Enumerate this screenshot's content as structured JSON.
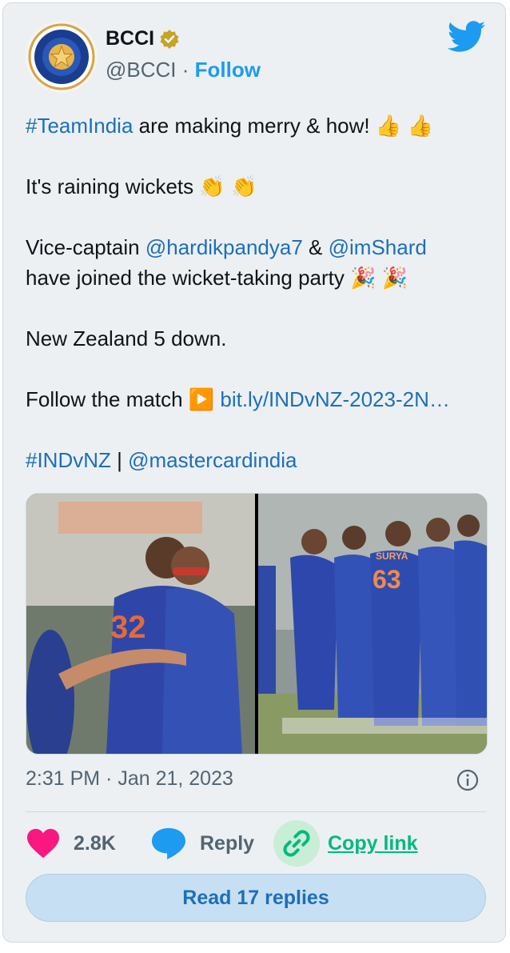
{
  "author": {
    "name": "BCCI",
    "handle": "@BCCI",
    "separator": "·",
    "follow_label": "Follow",
    "verified_color": "#c9a227"
  },
  "tweet": {
    "line1_hashtag": "#TeamIndia",
    "line1_text": " are making merry & how! ",
    "line1_emoji": "👍 👍",
    "line2_text": "It's raining wickets ",
    "line2_emoji": "👏 👏",
    "line3_text": "Vice-captain ",
    "line3_mention1": "@hardikpandya7",
    "line3_amp": " & ",
    "line3_mention2": "@imShard",
    "line4_text": "have joined the wicket-taking party ",
    "line4_emoji": "🎉 🎉",
    "line5_text": "New Zealand 5 down.",
    "line6_text": "Follow the match ",
    "line6_emoji": "▶️",
    "line6_link": "bit.ly/INDvNZ-2023-2N…",
    "line7_hashtag": "#INDvNZ",
    "line7_sep": " | ",
    "line7_mention": "@mastercardindia"
  },
  "media": {
    "photo1_icon": "celebration-photo-icon",
    "photo2_icon": "team-huddle-photo-icon",
    "jersey_name": "SURYA",
    "jersey_number": "63"
  },
  "meta": {
    "timestamp": "2:31 PM · Jan 21, 2023"
  },
  "actions": {
    "likes": "2.8K",
    "reply_label": "Reply",
    "copy_label": "Copy link"
  },
  "read_replies_label": "Read 17 replies",
  "colors": {
    "accent": "#1d9bf0",
    "link": "#1d6fb8",
    "heart": "#f91880",
    "copy": "#00ba7c"
  }
}
